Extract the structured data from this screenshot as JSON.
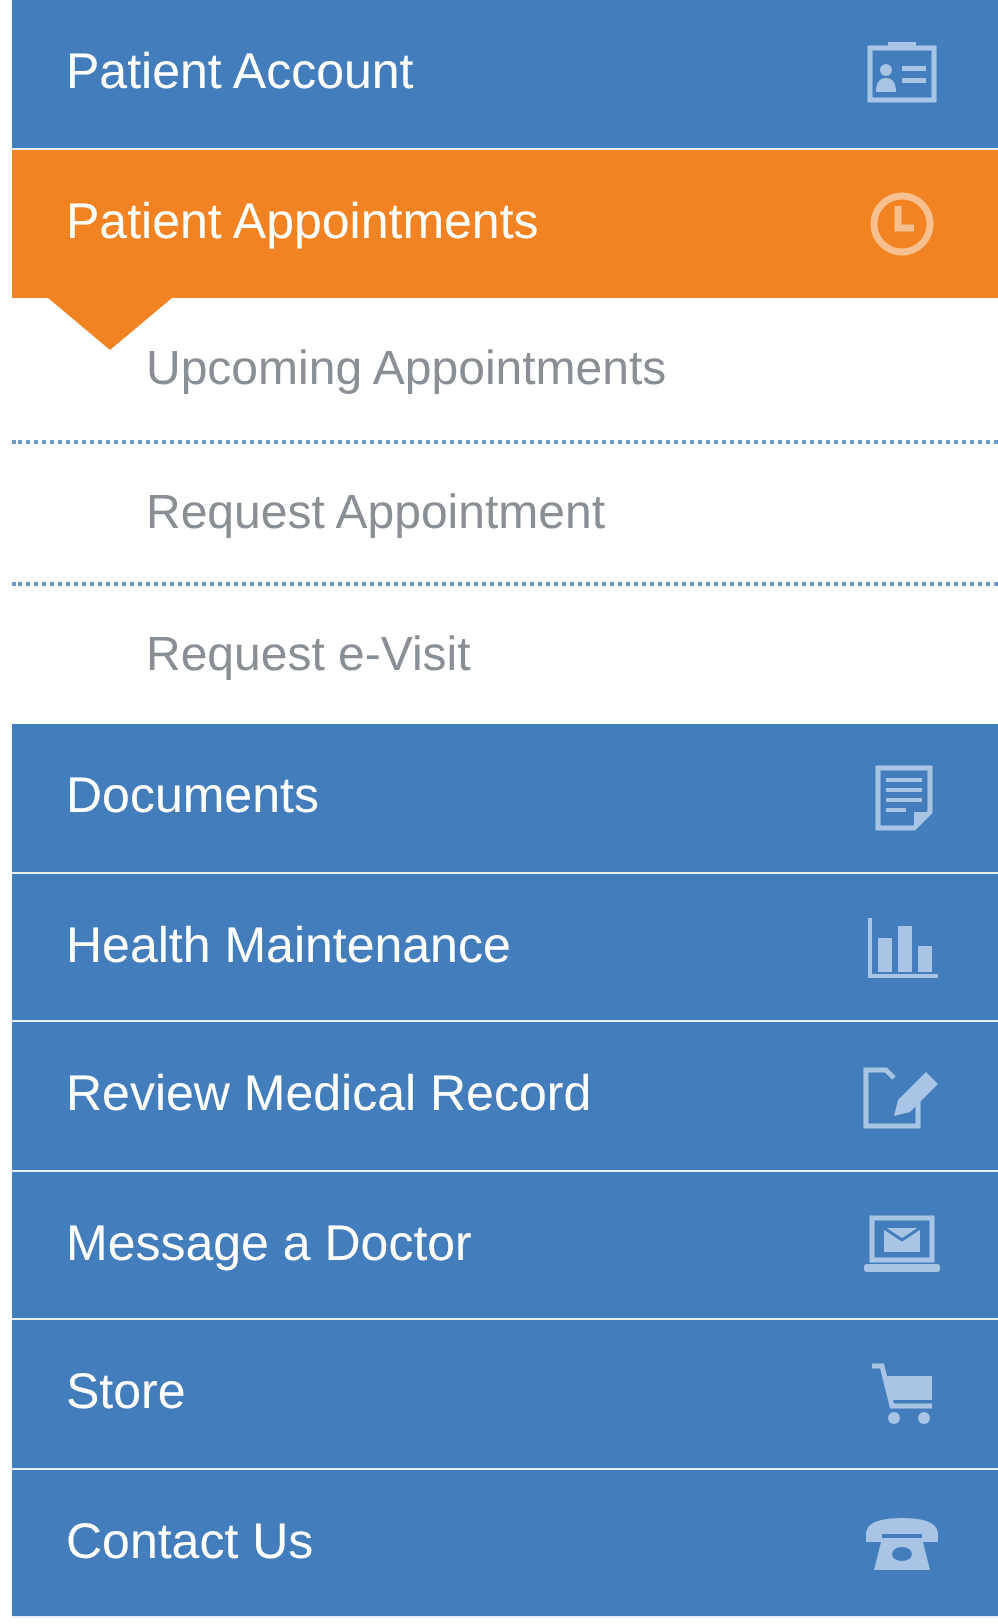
{
  "menu": [
    {
      "label": "Patient Account",
      "selected": false
    },
    {
      "label": "Patient Appointments",
      "selected": true,
      "expanded": true,
      "children": [
        {
          "label": "Upcoming Appointments"
        },
        {
          "label": "Request Appointment"
        },
        {
          "label": "Request e-Visit"
        }
      ]
    },
    {
      "label": "Documents",
      "selected": false
    },
    {
      "label": "Health Maintenance",
      "selected": false
    },
    {
      "label": "Review Medical Record",
      "selected": false
    },
    {
      "label": "Message a Doctor",
      "selected": false
    },
    {
      "label": "Store",
      "selected": false
    },
    {
      "label": "Contact Us",
      "selected": false
    }
  ]
}
